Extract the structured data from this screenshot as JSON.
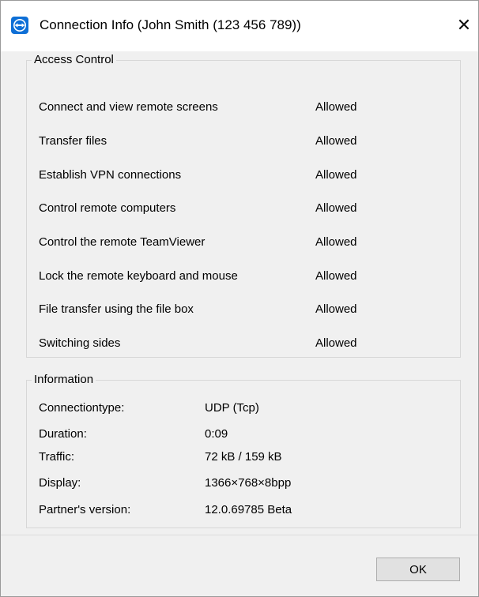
{
  "window": {
    "title": "Connection Info (John Smith (123 456 789))",
    "close_glyph": "✕"
  },
  "access_control": {
    "title": "Access Control",
    "rows": [
      {
        "label": "Connect and view remote screens",
        "value": "Allowed"
      },
      {
        "label": "Transfer files",
        "value": "Allowed"
      },
      {
        "label": "Establish VPN connections",
        "value": "Allowed"
      },
      {
        "label": "Control remote computers",
        "value": "Allowed"
      },
      {
        "label": "Control the remote TeamViewer",
        "value": "Allowed"
      },
      {
        "label": "Lock the remote keyboard and mouse",
        "value": "Allowed"
      },
      {
        "label": "File transfer using the file box",
        "value": "Allowed"
      },
      {
        "label": "Switching sides",
        "value": "Allowed"
      }
    ]
  },
  "information": {
    "title": "Information",
    "rows": [
      {
        "label": "Connectiontype:",
        "value": "UDP (Tcp)"
      },
      {
        "label": "Duration:",
        "value": "0:09"
      },
      {
        "label": "Traffic:",
        "value": "72 kB / 159 kB"
      },
      {
        "label": "Display:",
        "value": "1366×768×8bpp"
      },
      {
        "label": "Partner's version:",
        "value": "12.0.69785 Beta"
      }
    ]
  },
  "footer": {
    "ok_label": "OK"
  },
  "colors": {
    "accent": "#0e6fd6"
  },
  "icons": {
    "app": "teamviewer-icon",
    "close": "close-icon"
  }
}
